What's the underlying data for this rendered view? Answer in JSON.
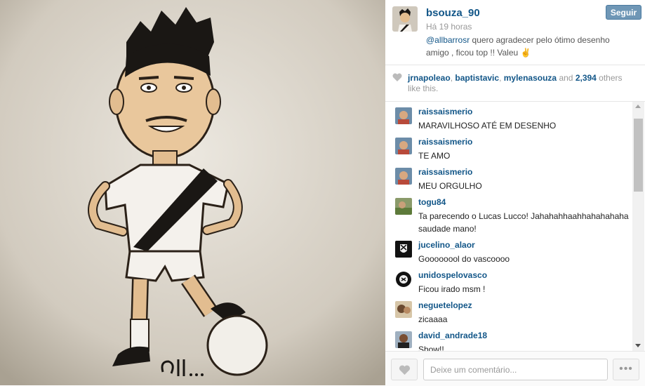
{
  "post": {
    "username": "bsouza_90",
    "time": "Há 19 horas",
    "caption_mention": "@allbarrosr",
    "caption_text": " quero agradecer pelo ótimo desenho amigo , ficou top !! Valeu ✌️",
    "follow_label": "Seguir"
  },
  "likes": {
    "user1": "jrnapoleao",
    "sep1": ", ",
    "user2": "baptistavic",
    "sep2": ", ",
    "user3": "mylenasouza",
    "and_text": " and ",
    "count": "2,394",
    "suffix": " others like this."
  },
  "comments": [
    {
      "user": "raissaismerio",
      "text": "MARAVILHOSO ATÉ EM DESENHO"
    },
    {
      "user": "raissaismerio",
      "text": "TE AMO"
    },
    {
      "user": "raissaismerio",
      "text": "MEU ORGULHO"
    },
    {
      "user": "togu84",
      "text": "Ta parecendo o Lucas Lucco! Jahahahhaahhahahahaha saudade mano!"
    },
    {
      "user": "jucelino_alaor",
      "text": "Goooooool do vascoooo"
    },
    {
      "user": "unidospelovasco",
      "text": "Ficou irado msm !"
    },
    {
      "user": "neguetelopez",
      "text": "zicaaaa"
    },
    {
      "user": "david_andrade18",
      "text": "Show!!"
    }
  ],
  "footer": {
    "comment_placeholder": "Deixe um comentário...",
    "more_label": "•••"
  },
  "colors": {
    "link": "#125688",
    "follow_button": "#6f97b6"
  },
  "icons": {
    "like": "heart-icon",
    "more": "more-options-icon"
  }
}
